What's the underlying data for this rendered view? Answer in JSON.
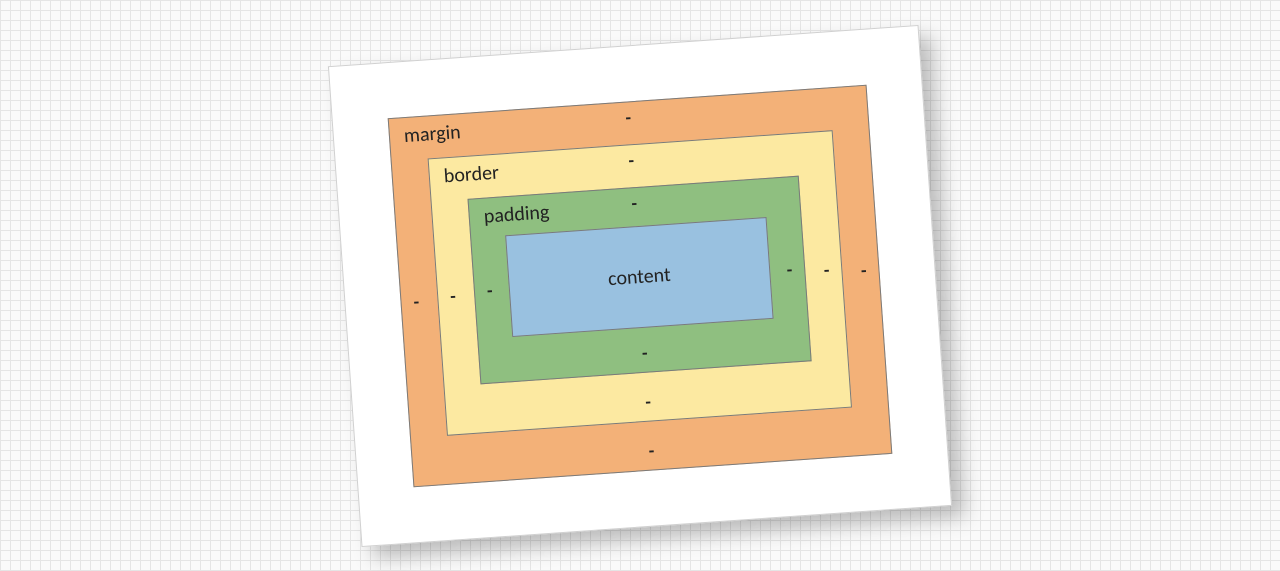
{
  "box_model": {
    "margin": {
      "label": "margin",
      "top": "-",
      "right": "-",
      "bottom": "-",
      "left": "-"
    },
    "border": {
      "label": "border",
      "top": "-",
      "right": "-",
      "bottom": "-",
      "left": "-"
    },
    "padding": {
      "label": "padding",
      "top": "-",
      "right": "-",
      "bottom": "-",
      "left": "-"
    },
    "content": {
      "label": "content"
    }
  },
  "colors": {
    "margin": "#f3b178",
    "border": "#fce9a1",
    "padding": "#8fbf80",
    "content": "#99c1e0"
  }
}
